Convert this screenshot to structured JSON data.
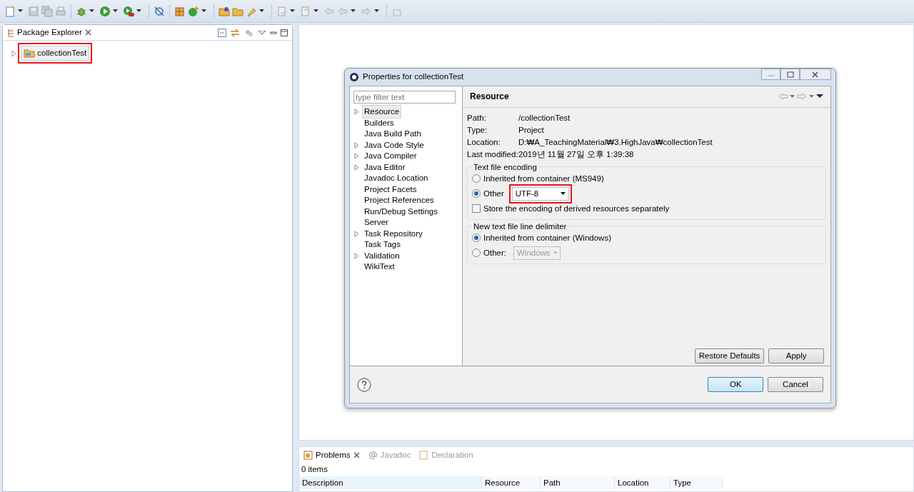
{
  "package_explorer": {
    "title": "Package Explorer",
    "tree": [
      {
        "label": "collectionTest",
        "expanded": false,
        "selected": true,
        "highlighted": true
      }
    ]
  },
  "dialog": {
    "title": "Properties for collectionTest",
    "filter": {
      "placeholder": "type filter text"
    },
    "nav": [
      {
        "label": "Resource",
        "expandable": true,
        "selected": true
      },
      {
        "label": "Builders",
        "expandable": false,
        "selected": false
      },
      {
        "label": "Java Build Path",
        "expandable": false,
        "selected": false
      },
      {
        "label": "Java Code Style",
        "expandable": true,
        "selected": false
      },
      {
        "label": "Java Compiler",
        "expandable": true,
        "selected": false
      },
      {
        "label": "Java Editor",
        "expandable": true,
        "selected": false
      },
      {
        "label": "Javadoc Location",
        "expandable": false,
        "selected": false
      },
      {
        "label": "Project Facets",
        "expandable": false,
        "selected": false
      },
      {
        "label": "Project References",
        "expandable": false,
        "selected": false
      },
      {
        "label": "Run/Debug Settings",
        "expandable": false,
        "selected": false
      },
      {
        "label": "Server",
        "expandable": false,
        "selected": false
      },
      {
        "label": "Task Repository",
        "expandable": true,
        "selected": false
      },
      {
        "label": "Task Tags",
        "expandable": false,
        "selected": false
      },
      {
        "label": "Validation",
        "expandable": true,
        "selected": false
      },
      {
        "label": "WikiText",
        "expandable": false,
        "selected": false
      }
    ],
    "page_title": "Resource",
    "info": [
      {
        "label": "Path:",
        "value": "/collectionTest"
      },
      {
        "label": "Type:",
        "value": "Project"
      },
      {
        "label": "Location:",
        "value": "D:₩A_TeachingMaterial₩3.HighJava₩collectionTest"
      },
      {
        "label": "Last modified:",
        "value": "2019년 11월 27일 오후 1:39:38"
      }
    ],
    "encoding_group": {
      "title": "Text file encoding",
      "options": [
        {
          "label": "Inherited from container (MS949)",
          "selected": false
        },
        {
          "label": "Other",
          "selected": true,
          "value": "UTF-8",
          "disabled": false,
          "highlighted": true
        }
      ],
      "store_separately": {
        "label": "Store the encoding of derived resources separately",
        "checked": false
      }
    },
    "delimiter_group": {
      "title": "New text file line delimiter",
      "options": [
        {
          "label": "Inherited from container (Windows)",
          "selected": true
        },
        {
          "label": "Other:",
          "selected": false,
          "value": "Windows",
          "disabled": true
        }
      ]
    },
    "page_buttons": [
      {
        "label": "Restore Defaults",
        "default": false
      },
      {
        "label": "Apply",
        "default": false
      }
    ],
    "buttons": [
      {
        "label": "OK",
        "default": true
      },
      {
        "label": "Cancel",
        "default": false
      }
    ]
  },
  "bottom_panel": {
    "tabs": [
      {
        "label": "Problems",
        "selected": true
      },
      {
        "label": "Javadoc",
        "selected": false
      },
      {
        "label": "Declaration",
        "selected": false
      }
    ],
    "summary": "0 items",
    "columns": [
      "Description",
      "Resource",
      "Path",
      "Location",
      "Type"
    ]
  }
}
